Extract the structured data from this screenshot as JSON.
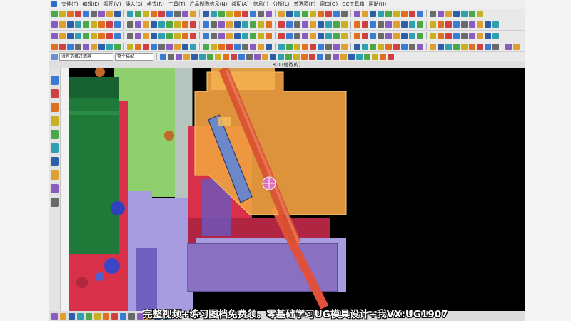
{
  "menubar": {
    "items": [
      "文件(F)",
      "编辑(E)",
      "视图(V)",
      "插入(S)",
      "格式(R)",
      "工具(T)",
      "产品制造信息(N)",
      "装配(A)",
      "信息(I)",
      "分析(L)",
      "首选项(P)",
      "窗口(O)",
      "GC工具箱",
      "帮助(H)"
    ]
  },
  "selection_bar": {
    "filter_value": "没有选择过滤器",
    "scope_value": "整个装配"
  },
  "window_title": "8.0 (修改的)",
  "icons": {
    "toolbar": "cad-tool-icon",
    "sidebar": [
      "assembly-navigator-icon",
      "constraint-navigator-icon",
      "part-navigator-icon",
      "reuse-library-icon",
      "history-icon",
      "system-materials-icon",
      "process-studio-icon",
      "roles-icon",
      "web-browser-icon",
      "palette-icon"
    ],
    "cursor": "crosshair-cursor-icon"
  },
  "colors": {
    "viewport_background": "#000000",
    "green_plate": "#8fcf6e",
    "dark_green_block": "#1f7a3a",
    "orange_slider": "#f0a040",
    "red_part": "#d83048",
    "lavender_plate": "#a89ce0",
    "purple_block": "#8a70c0",
    "caption_text": "#ffffff"
  },
  "caption": {
    "text": "完整视频+练习图档免费领。零基础学习UG模具设计+我VX:UG1907"
  }
}
